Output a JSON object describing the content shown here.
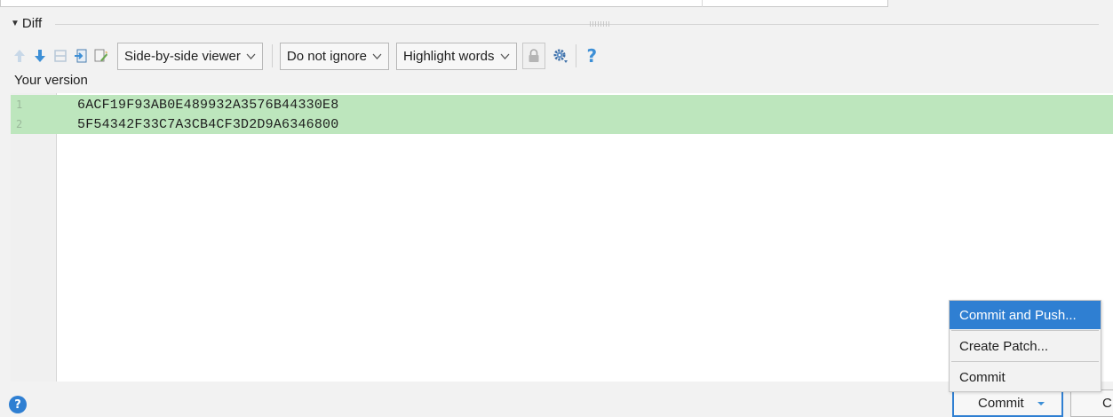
{
  "diff": {
    "section_label": "Diff"
  },
  "toolbar": {
    "viewer_select": "Side-by-side viewer",
    "ignore_select": "Do not ignore",
    "highlight_select": "Highlight words",
    "help_label": "?"
  },
  "editor": {
    "version_label": "Your version",
    "lines": [
      {
        "number": "1",
        "text": "6ACF19F93AB0E489932A3576B44330E8"
      },
      {
        "number": "2",
        "text": "5F54342F33C7A3CB4CF3D2D9A6346800"
      }
    ]
  },
  "commit_menu": {
    "items": [
      {
        "label": "Commit and Push...",
        "selected": true
      },
      {
        "label": "Create Patch...",
        "selected": false
      },
      {
        "label": "Commit",
        "selected": false
      }
    ]
  },
  "footer": {
    "help_label": "?",
    "commit_label": "Commit",
    "cancel_label": "C"
  },
  "colors": {
    "added_line": "#bde6bd",
    "accent": "#2f7fd2",
    "icon_blue": "#3d8fd6"
  }
}
